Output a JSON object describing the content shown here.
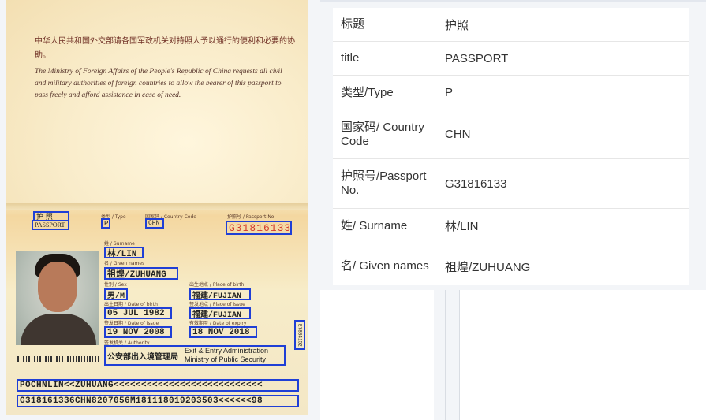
{
  "passport": {
    "cn_intro": "中华人民共和国外交部请各国军政机关对持照人予以通行的便利和必要的协助。",
    "en_intro": "The Ministry of Foreign Affairs of the People's Republic of China requests all civil and military authorities of foreign countries to allow the bearer of this passport to pass freely and afford assistance in case of need.",
    "labels": {
      "type": "类型 / Type",
      "country_code": "国家码 / Country Code",
      "passport_no": "护照号 / Passport No.",
      "surname": "姓 / Surname",
      "given_names": "名 / Given names",
      "sex": "性别 / Sex",
      "place_of_birth": "出生地点 / Place of birth",
      "date_of_birth": "出生日期 / Date of birth",
      "place_of_issue": "签发地点 / Place of issue",
      "date_of_issue": "签发日期 / Date of issue",
      "date_of_expiry": "有效期至 / Date of expiry",
      "authority": "签发机关 / Authority"
    },
    "title_cn": "护 照",
    "title_en": "PASSPORT",
    "type": "P",
    "country": "CHN",
    "number": "G31816133",
    "surname": "林/LIN",
    "given": "祖煌/ZUHUANG",
    "sex": "男/M",
    "birth_place": "福建/FUJIAN",
    "dob": "05 JUL 1982",
    "issue_place": "福建/FUJIAN",
    "issue_date": "19 NOV 2008",
    "expiry": "18 NOV 2018",
    "authority_cn": "公安部出入境管理局",
    "authority_en_1": "Exit & Entry Administration",
    "authority_en_2": "Ministry of Public Security",
    "side_code": "E7884152",
    "mrz1": "POCHNLIN<<ZUHUANG<<<<<<<<<<<<<<<<<<<<<<<<<<<",
    "mrz2": "G318161336CHN8207056M181118019203503<<<<<<98"
  },
  "table": {
    "rows": [
      {
        "key": "标题",
        "value": "护照"
      },
      {
        "key": "title",
        "value": "PASSPORT"
      },
      {
        "key": "类型/Type",
        "value": "P"
      },
      {
        "key": "国家码/ Country Code",
        "value": "CHN"
      },
      {
        "key": "护照号/Passport No.",
        "value": "G31816133"
      },
      {
        "key": "姓/ Surname",
        "value": "林/LIN"
      },
      {
        "key": "名/ Given names",
        "value": "祖煌/ZUHUANG"
      }
    ]
  }
}
